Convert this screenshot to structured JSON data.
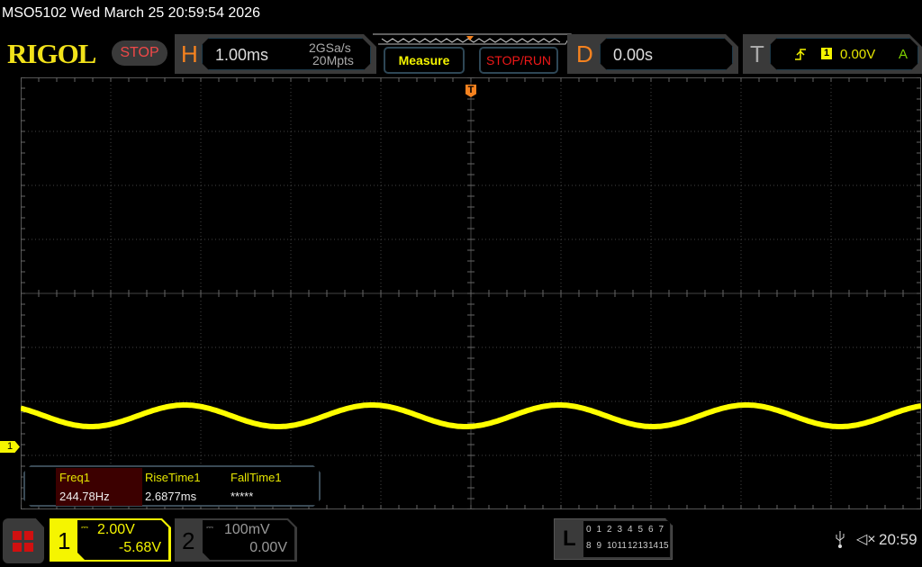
{
  "header": {
    "title": "MSO5102  Wed March 25 20:59:54 2026",
    "logo": "RIGOL",
    "run_state": "STOP"
  },
  "horizontal": {
    "label": "H",
    "timebase": "1.00ms",
    "sample_rate": "2GSa/s",
    "memory_depth": "20Mpts"
  },
  "buttons": {
    "measure": "Measure",
    "stop_run": "STOP/RUN"
  },
  "delay": {
    "label": "D",
    "value": "0.00s"
  },
  "trigger": {
    "label": "T",
    "source": "1",
    "level": "0.00V",
    "mode": "A",
    "icon": "rising-edge-icon"
  },
  "measurements": [
    {
      "label": "Freq1",
      "value": "244.78Hz"
    },
    {
      "label": "RiseTime1",
      "value": "2.6877ms"
    },
    {
      "label": "FallTime1",
      "value": "*****"
    }
  ],
  "channels": [
    {
      "num": "1",
      "scale": "2.00V",
      "offset": "-5.68V",
      "active": true
    },
    {
      "num": "2",
      "scale": "100mV",
      "offset": "0.00V",
      "active": false
    }
  ],
  "ch1_marker": "1",
  "trigger_marker": "T",
  "logic": {
    "label": "L",
    "row1": [
      "0",
      "1",
      "2",
      "3",
      "4",
      "5",
      "6",
      "7"
    ],
    "row2": [
      "8",
      "9",
      "10",
      "11",
      "12",
      "13",
      "14",
      "15"
    ]
  },
  "status": {
    "time": "20:59",
    "usb_icon": "usb-icon",
    "sound_icon": "speaker-muted-icon"
  },
  "colors": {
    "ch1": "#ffff00",
    "accent": "#f5821f",
    "stop": "#f04848"
  }
}
